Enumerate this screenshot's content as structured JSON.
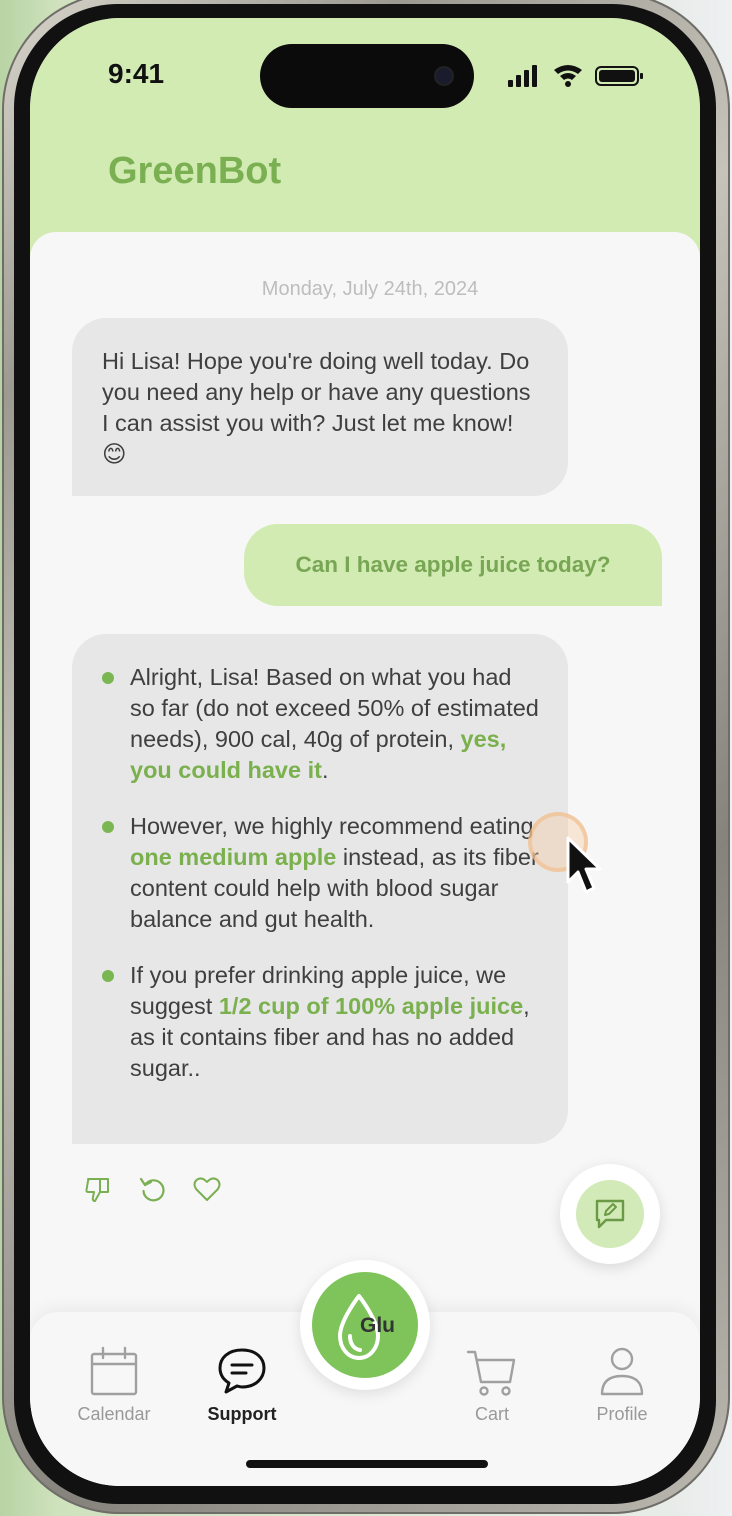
{
  "status_bar": {
    "time": "9:41"
  },
  "header": {
    "title": "GreenBot"
  },
  "chat": {
    "date": "Monday, July 24th, 2024",
    "bot_message_1": "Hi Lisa! Hope you're doing well today. Do you need any help or have any questions I can assist you with? Just let me know! 😊",
    "user_message": "Can I have apple juice today?",
    "bot_message_2": {
      "bullet_1": {
        "text_before": "Alright, Lisa! Based on what you had so far (do not exceed 50% of estimated needs), 900 cal, 40g of protein, ",
        "highlight": "yes, you could have it",
        "text_after": "."
      },
      "bullet_2": {
        "text_before": "However, we highly recommend eating ",
        "highlight": "one medium apple",
        "text_after": " instead, as its fiber content could help with blood sugar balance and gut health."
      },
      "bullet_3": {
        "text_before": "If you prefer drinking apple juice, we suggest ",
        "highlight": "1/2 cup of 100% apple juice",
        "text_after": ", as it contains fiber and has no added sugar.."
      }
    },
    "actions": [
      "thumbs-down-icon",
      "regenerate-icon",
      "heart-icon"
    ]
  },
  "fab": {
    "icon": "new-chat-icon"
  },
  "center_button": {
    "label": "Glu"
  },
  "nav": {
    "calendar": "Calendar",
    "support": "Support",
    "cart": "Cart",
    "profile": "Profile",
    "active": "Support"
  },
  "colors": {
    "header_bg": "#d1ebb2",
    "brand_green": "#7bb052",
    "user_bubble_bg": "#d1ebb2",
    "bot_bubble_bg": "#e7e7e7",
    "glu_button": "#7ec45a"
  }
}
